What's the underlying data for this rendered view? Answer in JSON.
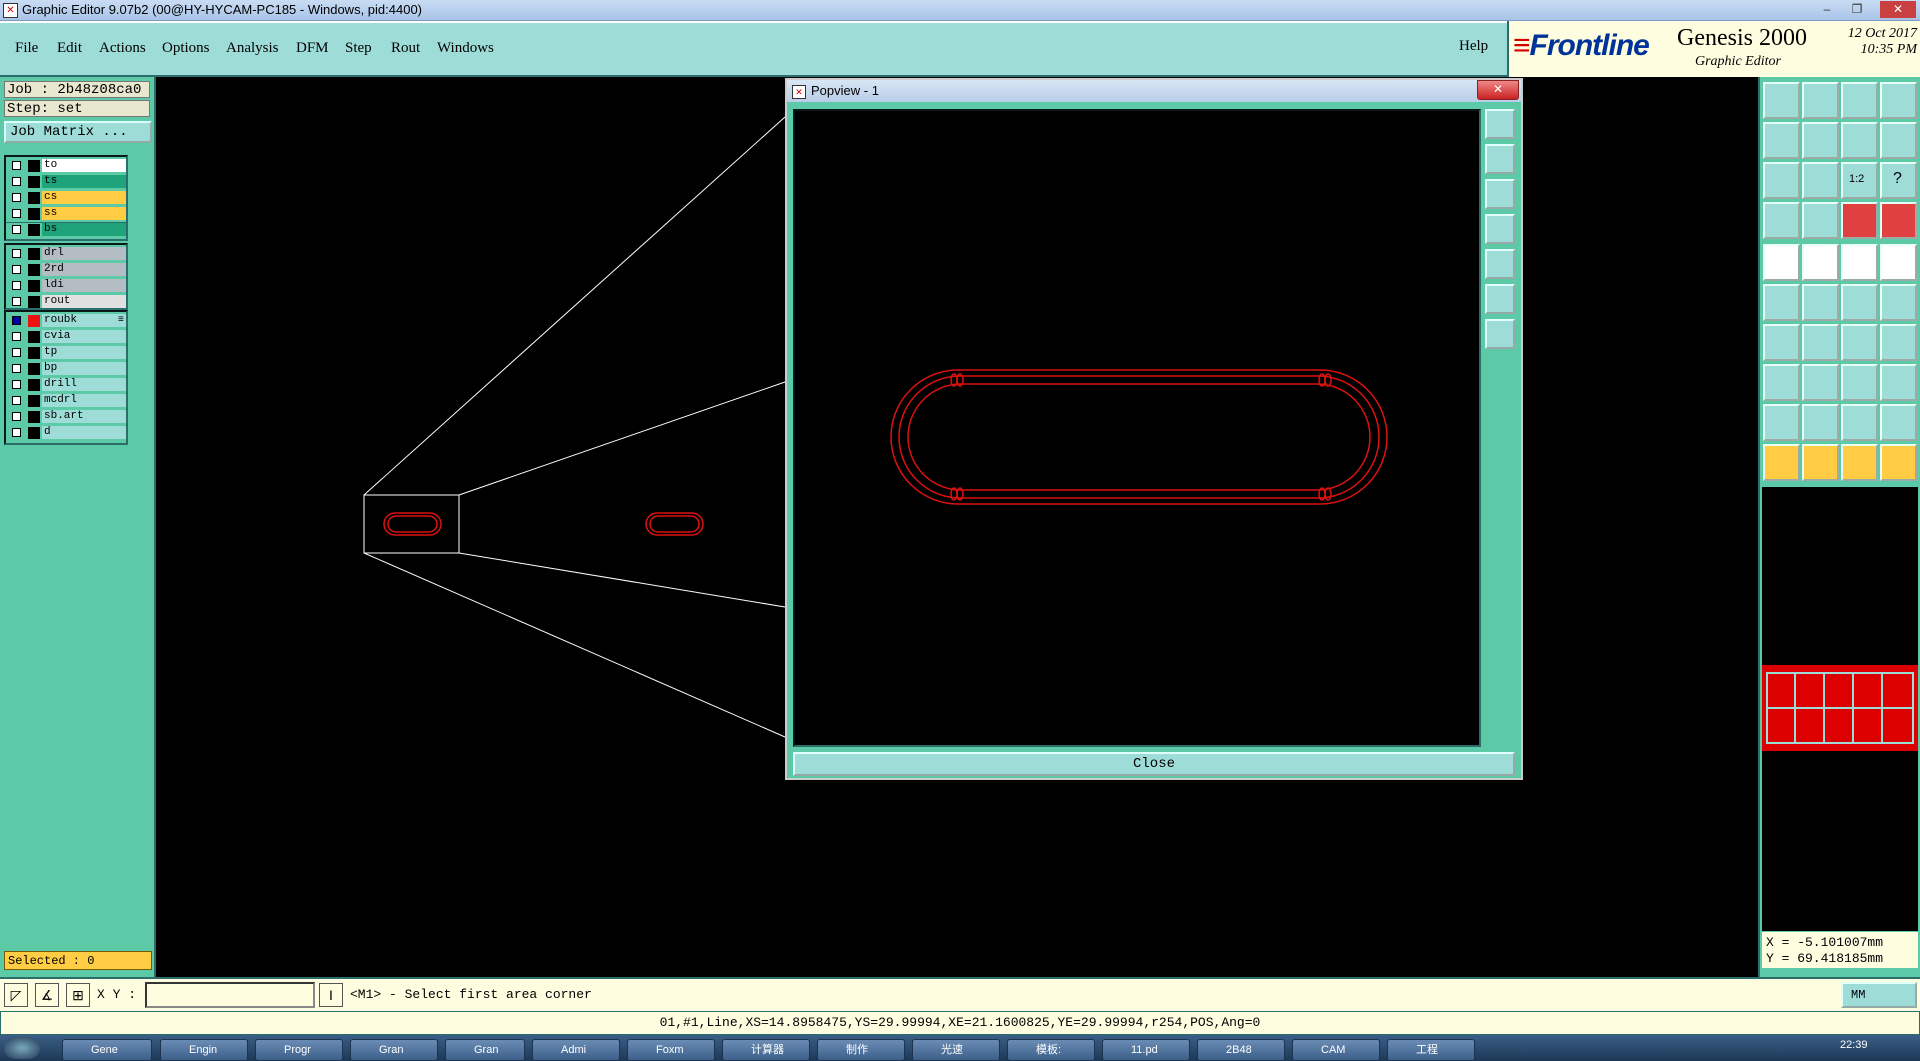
{
  "window": {
    "title": "Graphic Editor 9.07b2 (00@HY-HYCAM-PC185 - Windows, pid:4400)",
    "minimize": "–",
    "restore": "❐",
    "close": "✕"
  },
  "menu": {
    "items": [
      "File",
      "Edit",
      "Actions",
      "Options",
      "Analysis",
      "DFM",
      "Step",
      "Rout",
      "Windows"
    ],
    "help": "Help"
  },
  "branding": {
    "frontline": "Frontline",
    "product": "Genesis 2000",
    "subtitle": "Graphic Editor",
    "date": "12 Oct 2017",
    "time": "10:35 PM"
  },
  "left": {
    "job": "Job : 2b48z08ca0",
    "step": "Step: set",
    "job_matrix": "Job Matrix ...",
    "groups": [
      {
        "layers": [
          {
            "name": "to",
            "color": "#ffffff"
          },
          {
            "name": "ts",
            "color": "#1fa37a"
          },
          {
            "name": "cs",
            "color": "#ffcc44"
          },
          {
            "name": "ss",
            "color": "#ffcc44"
          },
          {
            "name": "bs",
            "color": "#1fa37a"
          }
        ]
      },
      {
        "layers": [
          {
            "name": "drl",
            "color": "#b4bcc4"
          },
          {
            "name": "2rd",
            "color": "#b4bcc4"
          },
          {
            "name": "ldi",
            "color": "#b4bcc4"
          },
          {
            "name": "rout",
            "color": "#e0e0e0"
          }
        ]
      },
      {
        "layers": [
          {
            "name": "roubk",
            "color": "#9edcd8",
            "active": true,
            "mark": "≡"
          },
          {
            "name": "cvia",
            "color": "#9edcd8"
          },
          {
            "name": "tp",
            "color": "#9edcd8"
          },
          {
            "name": "bp",
            "color": "#9edcd8"
          },
          {
            "name": "drill",
            "color": "#9edcd8"
          },
          {
            "name": "mcdrl",
            "color": "#9edcd8"
          },
          {
            "name": "sb.art",
            "color": "#9edcd8"
          },
          {
            "name": "d",
            "color": "#9edcd8"
          }
        ]
      }
    ],
    "selected": "Selected : 0"
  },
  "popview": {
    "title": "Popview - 1",
    "close_label": "Close",
    "close_x": "✕"
  },
  "coords": {
    "x": "X = -5.101007mm",
    "y": "Y = 69.418185mm"
  },
  "bottom": {
    "xy_label": "X Y :",
    "xy_value": "",
    "message": "<M1> - Select first area corner",
    "units": "MM"
  },
  "status": "01,#1,Line,XS=14.8958475,YS=29.99994,XE=21.1600825,YE=29.99994,r254,POS,Ang=0",
  "taskbar": {
    "items": [
      "Gene",
      "Engin",
      "Progr",
      "Gran",
      "Gran",
      "Admi",
      "Foxm",
      "计算器",
      "制作",
      "光速",
      "模板:",
      "11.pd",
      "2B48",
      "CAM",
      "工程"
    ],
    "clock": "22:39"
  },
  "colors": {
    "panel": "#5cc9a7",
    "menu": "#9edcd8",
    "outline": "#dd1111"
  }
}
